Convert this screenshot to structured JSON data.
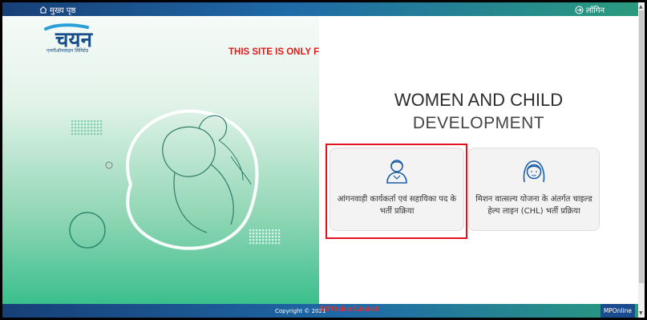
{
  "topbar": {
    "home_label": "मुख्य पृष्ठ",
    "login_label": "लॉगिन"
  },
  "logo": {
    "text": "चयन",
    "subtext": "एमपीऑनलाइन लिमिटेड"
  },
  "demo_notice": "THIS SITE IS ONLY FOR DEMO PURPOSE.",
  "heading": {
    "line1": "WOMEN AND CHILD",
    "line2": "DEVELOPMENT"
  },
  "cards": [
    {
      "label": "आंगनवाड़ी कार्यकर्ता एवं सहायिका पद के भर्ती प्रक्रिया"
    },
    {
      "label": "मिशन वात्सल्य योजना के अंतर्गत चाइल्ड हेल्प लाइन (CHL) भर्ती प्रक्रिया"
    }
  ],
  "footer": {
    "copyright": "Copyright © 2021",
    "brand_logo_text": "MPOnline Limited",
    "brand_right": "MPOnline"
  },
  "colors": {
    "accent_blue": "#1f6aa8",
    "accent_green": "#2a9b7e",
    "selection_red": "#e0141e",
    "demo_red": "#e01b1b"
  },
  "icons": [
    "home-icon",
    "login-arrow-icon",
    "worker-icon",
    "child-girl-icon"
  ]
}
